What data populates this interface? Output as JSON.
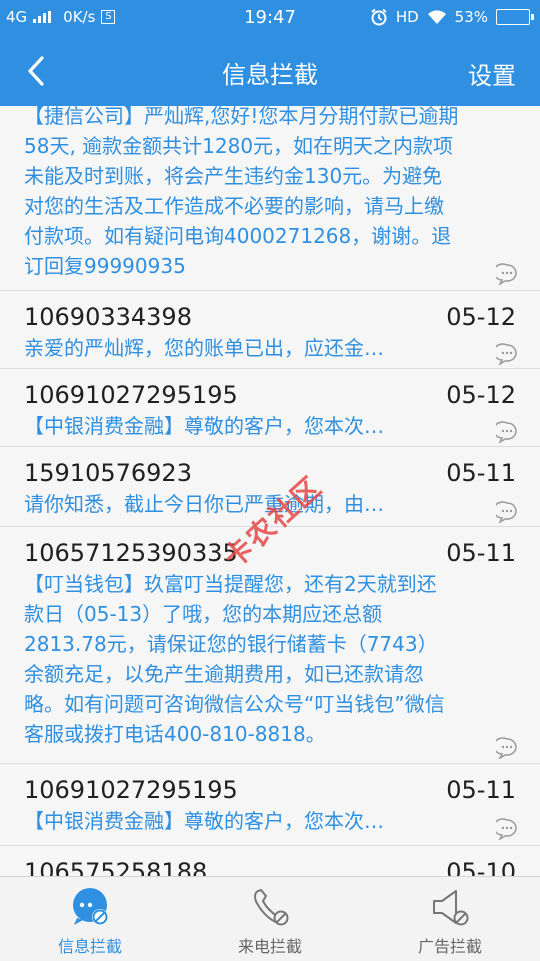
{
  "status": {
    "network": "4G",
    "speed": "0K/s",
    "s_icon": "S",
    "time": "19:47",
    "hd": "HD",
    "battery": "53%"
  },
  "nav": {
    "title": "信息拦截",
    "settings": "设置"
  },
  "messages": [
    {
      "number": "",
      "date": "",
      "body": "【捷信公司】严灿辉,您好!您本月分期付款已逾期58天, 逾款金额共计1280元，如在明天之内款项未能及时到账，将会产生违约金130元。为避免对您的生活及工作造成不必要的影响，请马上缴付款项。如有疑问电询4000271268，谢谢。退订回复99990935"
    },
    {
      "number": "10690334398",
      "date": "05-12",
      "body": "亲爱的严灿辉，您的账单已出，应还金…"
    },
    {
      "number": "10691027295195",
      "date": "05-12",
      "body": "【中银消费金融】尊敬的客户，您本次…"
    },
    {
      "number": "15910576923",
      "date": "05-11",
      "body": "请你知悉，截止今日你已严重逾期，由…"
    },
    {
      "number": "10657125390335",
      "date": "05-11",
      "body": "【叮当钱包】玖富叮当提醒您，还有2天就到还款日（05-13）了哦，您的本期应还总额2813.78元，请保证您的银行储蓄卡（7743）余额充足，以免产生逾期费用，如已还款请忽略。如有问题可咨询微信公众号“叮当钱包”微信客服或拨打电话400-810-8818。"
    },
    {
      "number": "10691027295195",
      "date": "05-11",
      "body": "【中银消费金融】尊敬的客户，您本次…"
    },
    {
      "number": "106575258188",
      "date": "05-10",
      "body": ""
    }
  ],
  "watermark": "卡农社区",
  "tabs": [
    {
      "label": "信息拦截",
      "icon": "message-block-icon",
      "active": true
    },
    {
      "label": "来电拦截",
      "icon": "phone-block-icon",
      "active": false
    },
    {
      "label": "广告拦截",
      "icon": "ad-block-icon",
      "active": false
    }
  ],
  "colors": {
    "accent": "#2f8fe0",
    "text": "#202020"
  }
}
